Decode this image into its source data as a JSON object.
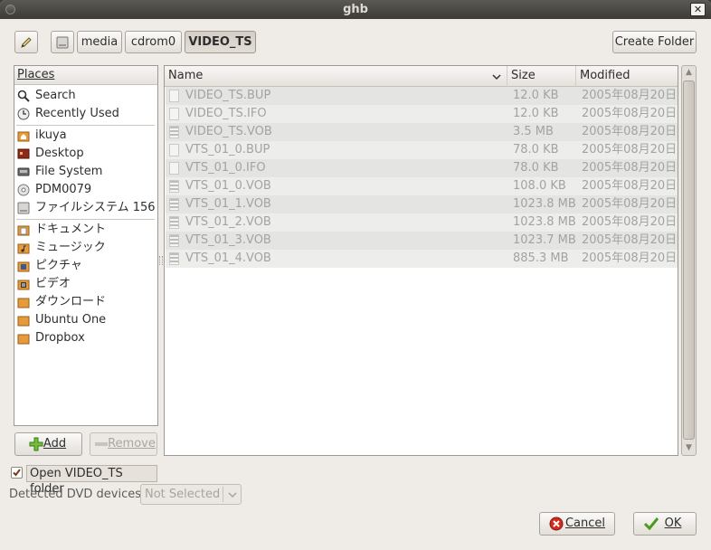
{
  "window": {
    "title": "ghb"
  },
  "path_bar": {
    "edit_icon": "pencil-icon",
    "drive_icon": "drive-icon",
    "segments": [
      "media",
      "cdrom0",
      "VIDEO_TS"
    ],
    "create_folder_label": "Create Folder"
  },
  "places": {
    "header": "Places",
    "items": [
      {
        "label": "Search",
        "icon": "search-icon"
      },
      {
        "label": "Recently Used",
        "icon": "clock-icon"
      },
      {
        "label": "ikuya",
        "icon": "home-folder-icon"
      },
      {
        "label": "Desktop",
        "icon": "desktop-icon"
      },
      {
        "label": "File System",
        "icon": "filesystem-icon"
      },
      {
        "label": "PDM0079",
        "icon": "cdrom-icon"
      },
      {
        "label": "ファイルシステム 156…",
        "icon": "drive-icon"
      },
      {
        "label": "ドキュメント",
        "icon": "documents-folder-icon"
      },
      {
        "label": "ミュージック",
        "icon": "music-folder-icon"
      },
      {
        "label": "ピクチャ",
        "icon": "pictures-folder-icon"
      },
      {
        "label": "ビデオ",
        "icon": "videos-folder-icon"
      },
      {
        "label": "ダウンロード",
        "icon": "folder-icon"
      },
      {
        "label": "Ubuntu One",
        "icon": "folder-icon"
      },
      {
        "label": "Dropbox",
        "icon": "folder-icon"
      }
    ],
    "add_label": "Add",
    "remove_label": "Remove"
  },
  "files": {
    "columns": {
      "name": "Name",
      "size": "Size",
      "modified": "Modified"
    },
    "rows": [
      {
        "name": "VIDEO_TS.BUP",
        "size": "12.0 KB",
        "modified": "2005年08月20日",
        "icon": "file-icon"
      },
      {
        "name": "VIDEO_TS.IFO",
        "size": "12.0 KB",
        "modified": "2005年08月20日",
        "icon": "file-icon"
      },
      {
        "name": "VIDEO_TS.VOB",
        "size": "3.5 MB",
        "modified": "2005年08月20日",
        "icon": "video-file-icon"
      },
      {
        "name": "VTS_01_0.BUP",
        "size": "78.0 KB",
        "modified": "2005年08月20日",
        "icon": "file-icon"
      },
      {
        "name": "VTS_01_0.IFO",
        "size": "78.0 KB",
        "modified": "2005年08月20日",
        "icon": "file-icon"
      },
      {
        "name": "VTS_01_0.VOB",
        "size": "108.0 KB",
        "modified": "2005年08月20日",
        "icon": "video-file-icon"
      },
      {
        "name": "VTS_01_1.VOB",
        "size": "1023.8 MB",
        "modified": "2005年08月20日",
        "icon": "video-file-icon"
      },
      {
        "name": "VTS_01_2.VOB",
        "size": "1023.8 MB",
        "modified": "2005年08月20日",
        "icon": "video-file-icon"
      },
      {
        "name": "VTS_01_3.VOB",
        "size": "1023.7 MB",
        "modified": "2005年08月20日",
        "icon": "video-file-icon"
      },
      {
        "name": "VTS_01_4.VOB",
        "size": "885.3 MB",
        "modified": "2005年08月20日",
        "icon": "video-file-icon"
      }
    ]
  },
  "options": {
    "open_folder_label": "Open VIDEO_TS folder",
    "open_folder_checked": true,
    "dvd_label": "Detected DVD devices:",
    "dvd_value": "Not Selected"
  },
  "actions": {
    "cancel_label": "Cancel",
    "ok_label": "OK"
  },
  "colors": {
    "titlebar": "#3c3b37",
    "dialog_bg": "#efebe7",
    "row_alt": "#ededec",
    "ok_check": "#4a9a1e",
    "cancel_red": "#d12b1f"
  }
}
